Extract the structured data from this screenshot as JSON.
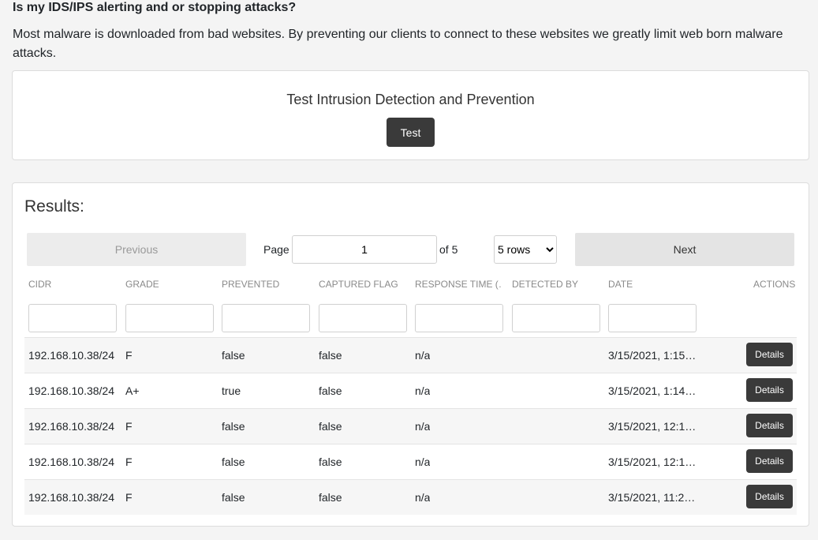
{
  "header": {
    "question": "Is my IDS/IPS alerting and or stopping attacks?",
    "description": "Most malware is downloaded from bad websites. By preventing our clients to connect to these websites we greatly limit web born malware attacks."
  },
  "test_card": {
    "title": "Test Intrusion Detection and Prevention",
    "button_label": "Test"
  },
  "results": {
    "title": "Results:",
    "pagination": {
      "previous_label": "Previous",
      "next_label": "Next",
      "page_label": "Page",
      "page_value": "1",
      "of_label": "of 5",
      "rows_selected": "5 rows"
    },
    "columns": [
      "CIDR",
      "GRADE",
      "PREVENTED",
      "CAPTURED FLAG",
      "RESPONSE TIME (…",
      "DETECTED BY",
      "DATE",
      "ACTIONS"
    ],
    "rows": [
      {
        "cidr": "192.168.10.38/24",
        "grade": "F",
        "prevented": "false",
        "captured_flag": "false",
        "response_time": "n/a",
        "detected_by": "",
        "date": "3/15/2021, 1:15…",
        "action": "Details"
      },
      {
        "cidr": "192.168.10.38/24",
        "grade": "A+",
        "prevented": "true",
        "captured_flag": "false",
        "response_time": "n/a",
        "detected_by": "",
        "date": "3/15/2021, 1:14…",
        "action": "Details"
      },
      {
        "cidr": "192.168.10.38/24",
        "grade": "F",
        "prevented": "false",
        "captured_flag": "false",
        "response_time": "n/a",
        "detected_by": "",
        "date": "3/15/2021, 12:1…",
        "action": "Details"
      },
      {
        "cidr": "192.168.10.38/24",
        "grade": "F",
        "prevented": "false",
        "captured_flag": "false",
        "response_time": "n/a",
        "detected_by": "",
        "date": "3/15/2021, 12:1…",
        "action": "Details"
      },
      {
        "cidr": "192.168.10.38/24",
        "grade": "F",
        "prevented": "false",
        "captured_flag": "false",
        "response_time": "n/a",
        "detected_by": "",
        "date": "3/15/2021, 11:2…",
        "action": "Details"
      }
    ]
  },
  "icons": {
    "sort": "sort-icon"
  },
  "colors": {
    "button_dark": "#3a3a3a",
    "page_background": "#f4f4f4",
    "row_stripe": "#f6f6f6"
  }
}
